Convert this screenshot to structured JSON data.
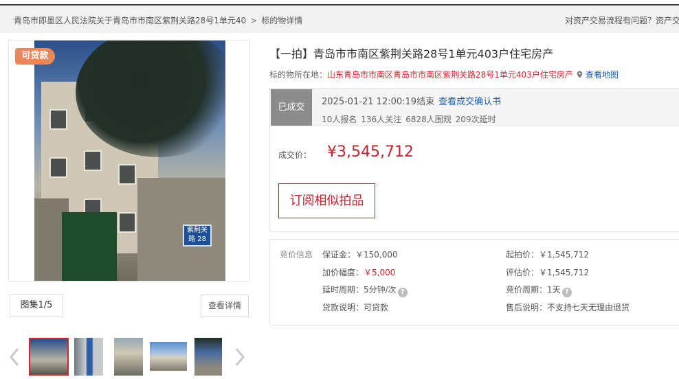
{
  "breadcrumb": {
    "court": "青岛市即墨区人民法院关于青岛市市南区紫荆关路28号1单元40",
    "sep": ">",
    "current": "标的物详情"
  },
  "help_text": "对资产交易流程有问题？资产交",
  "media": {
    "badge": "可贷款",
    "plate_text": "紫荆关路 28",
    "gallery_label": "图集1/5",
    "detail_button": "查看详情",
    "prev_icon": "chevron-left-icon",
    "next_icon": "chevron-right-icon"
  },
  "item": {
    "title": "【一拍】青岛市市南区紫荆关路28号1单元403户住宅房产",
    "location_label": "标的物所在地：",
    "location": "山东青岛市市南区青岛市市南区紫荆关路28号1单元403户住宅房产",
    "map_link": "查看地图"
  },
  "status": {
    "state": "已成交",
    "end_time": "2025-01-21 12:00:19结束",
    "confirm_link": "查看成交确认书",
    "registrations": "10人报名",
    "followers": "136人关注",
    "viewers": "6828人围观",
    "delays": "209次延时",
    "price_label": "成交价：",
    "price": "¥3,545,712",
    "subscribe_button": "订阅相似拍品"
  },
  "bidding_info": {
    "section_label": "竞价信息",
    "deposit": "保证金：￥150,000",
    "increment_label": "加价幅度：",
    "increment_value": "￥5,000",
    "delay_cycle": "延时周期：5分钟/次",
    "loan": "贷款说明：可贷款",
    "start_price": "起拍价：￥1,545,712",
    "appraisal": "评估价：￥1,545,712",
    "bid_cycle": "竞价周期：1天",
    "after_sale": "售后说明：不支持七天无理由退货",
    "help_glyph": "?"
  },
  "colors": {
    "accent_red": "#c8232c",
    "link_blue": "#1a5fb4",
    "badge_orange": "#e8885a",
    "done_gray": "#8c8c8c"
  }
}
